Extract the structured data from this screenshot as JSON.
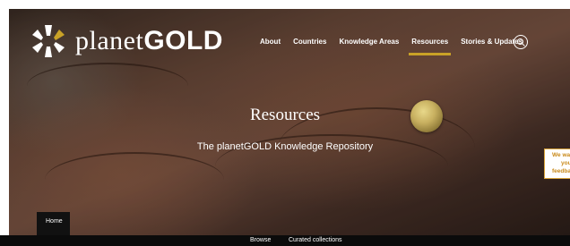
{
  "logo": {
    "word_planet": "planet",
    "word_gold": "GOLD",
    "mark_colors": [
      "#ffffff",
      "#c9a227"
    ]
  },
  "nav": {
    "items": [
      {
        "label": "About",
        "active": false
      },
      {
        "label": "Countries",
        "active": false
      },
      {
        "label": "Knowledge Areas",
        "active": false
      },
      {
        "label": "Resources",
        "active": true
      },
      {
        "label": "Stories & Updates",
        "active": false
      }
    ],
    "search_icon": "search-icon",
    "accent_color": "#c9a227"
  },
  "hero": {
    "title": "Resources",
    "subtitle": "The planetGOLD Knowledge Repository"
  },
  "feedback": {
    "line1": "We wa",
    "line2": "your",
    "line3": "feedba"
  },
  "breadcrumb": {
    "label": "Home"
  },
  "bottom_tabs": [
    "Browse",
    "Curated collections"
  ]
}
